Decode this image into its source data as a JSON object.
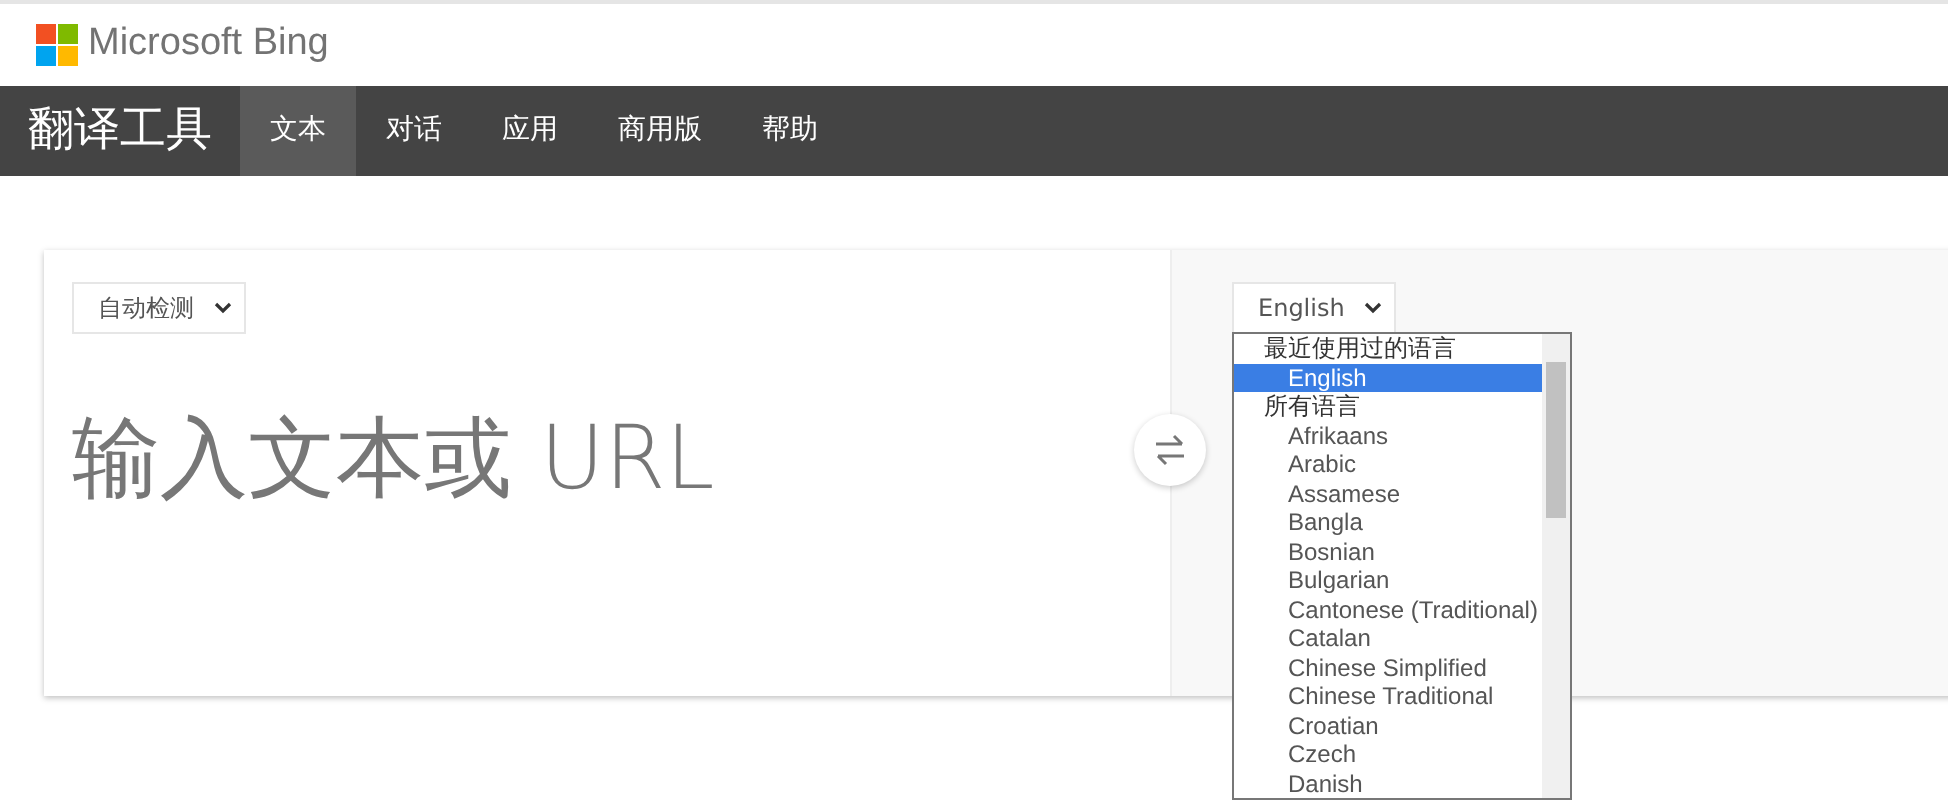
{
  "header": {
    "brand": "Microsoft Bing"
  },
  "nav": {
    "title": "翻译工具",
    "tabs": [
      {
        "label": "文本",
        "selected": true
      },
      {
        "label": "对话",
        "selected": false
      },
      {
        "label": "应用",
        "selected": false
      },
      {
        "label": "商用版",
        "selected": false
      },
      {
        "label": "帮助",
        "selected": false
      }
    ]
  },
  "source": {
    "language": "自动检测",
    "placeholder": "输入文本或 URL"
  },
  "target": {
    "language": "English",
    "dropdown": {
      "groups": [
        {
          "label": "最近使用过的语言",
          "options": [
            {
              "label": "English",
              "selected": true
            }
          ]
        },
        {
          "label": "所有语言",
          "options": [
            {
              "label": "Afrikaans",
              "selected": false
            },
            {
              "label": "Arabic",
              "selected": false
            },
            {
              "label": "Assamese",
              "selected": false
            },
            {
              "label": "Bangla",
              "selected": false
            },
            {
              "label": "Bosnian",
              "selected": false
            },
            {
              "label": "Bulgarian",
              "selected": false
            },
            {
              "label": "Cantonese (Traditional)",
              "selected": false
            },
            {
              "label": "Catalan",
              "selected": false
            },
            {
              "label": "Chinese Simplified",
              "selected": false
            },
            {
              "label": "Chinese Traditional",
              "selected": false
            },
            {
              "label": "Croatian",
              "selected": false
            },
            {
              "label": "Czech",
              "selected": false
            },
            {
              "label": "Danish",
              "selected": false
            }
          ]
        }
      ]
    }
  }
}
